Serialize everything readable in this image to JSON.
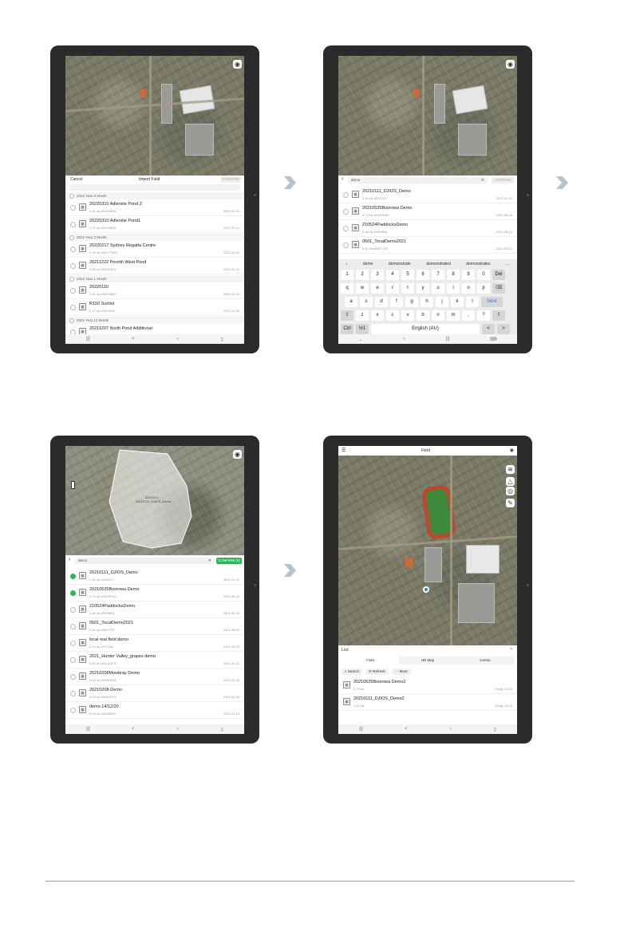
{
  "screen1": {
    "cancel": "Cancel",
    "title": "Import Field",
    "confirm": "CONFIRM",
    "groups": [
      {
        "label": "2022 Year 3 Month",
        "items": [
          {
            "name": "20220310 Adlerslie Pond 2",
            "sub": "0.46 ha #09158DA",
            "date": "2022-03-11"
          },
          {
            "name": "20220310 Adlerslie Pond1",
            "sub": "1.27 ha #09158DE",
            "date": "2022-03-10"
          }
        ]
      },
      {
        "label": "2022 Year 2 Month",
        "items": [
          {
            "name": "20220217 Sydney Regatta Centre",
            "sub": "0.39 ha #091779AC",
            "date": "2022-02-18"
          },
          {
            "name": "20211222 Penrith West Pond",
            "sub": "0.68 ha #09224DA",
            "date": "2022-02-22"
          }
        ]
      },
      {
        "label": "2022 Year 1 Month",
        "items": [
          {
            "name": "20220110",
            "sub": "0.01 ha #0923AB2",
            "date": "2022-01-10"
          },
          {
            "name": "R150 Sunlist",
            "sub": "0.17 ha #0923444",
            "date": "2022-01-06"
          }
        ]
      },
      {
        "label": "2021 Year 12 Month",
        "items": [
          {
            "name": "20211207 North Pond Additional",
            "sub": "",
            "date": ""
          }
        ]
      }
    ]
  },
  "screen2": {
    "search_value": "demo",
    "confirm": "CONFIRM",
    "items": [
      {
        "name": "20210111_DJIOS_Demo",
        "sub": "1.16 ha #0102C7",
        "date": "2021-01-11"
      },
      {
        "name": "20210525Boorowa Demo",
        "sub": "0.79 ha #09AFE8C",
        "date": "2021-05-25"
      },
      {
        "name": "210524PaddocksDemo",
        "sub": "0.48 ha #09A9B6",
        "date": "2021-05-24"
      },
      {
        "name": "0501_TocalDemo2021",
        "sub": "0.41 ha #0507767",
        "date": "2021-05-01"
      }
    ],
    "suggestions": [
      "demo",
      "demonstrate",
      "demonstrated",
      "demonstrates",
      "..."
    ],
    "keys_row1": [
      "1",
      "2",
      "3",
      "4",
      "5",
      "6",
      "7",
      "8",
      "9",
      "0",
      "Del"
    ],
    "keys_row2": [
      "q",
      "w",
      "e",
      "r",
      "t",
      "y",
      "u",
      "i",
      "o",
      "p",
      "⌫"
    ],
    "keys_row3": [
      "a",
      "s",
      "d",
      "f",
      "g",
      "h",
      "j",
      "k",
      "l",
      "Next"
    ],
    "keys_row4": [
      "⇧",
      "z",
      "x",
      "c",
      "v",
      "b",
      "n",
      "m",
      ",",
      "?",
      "⇧"
    ],
    "keys_row5": [
      "Ctrl",
      "!#1",
      "English (AU)",
      "<",
      ">"
    ]
  },
  "screen3": {
    "search_value": "demo",
    "confirm": "CONFIRM (2)",
    "field_label_1": "20210111",
    "field_label_2": "20210111_DJIOS_Demo",
    "items": [
      {
        "name": "20210111_DJIOS_Demo",
        "sub": "1.16 ha #0102C7",
        "date": "2021-01-11",
        "checked": true
      },
      {
        "name": "20210525Boorowa Demo",
        "sub": "0.79 ha #09AFE8C",
        "date": "2021-05-25",
        "checked": true
      },
      {
        "name": "210524PaddocksDemo",
        "sub": "0.48 ha #09A9B6",
        "date": "2021-05-24",
        "checked": false
      },
      {
        "name": "0501_TocalDemo2021",
        "sub": "0.41 ha #0507767",
        "date": "2021-05-01",
        "checked": false
      },
      {
        "name": "local real field demo",
        "sub": "0.33 ha #0175A6",
        "date": "2021-03-09",
        "checked": false
      },
      {
        "name": "2021_Hunter Valley_grapes demo",
        "sub": "0.55 ha #041A1F5",
        "date": "2021-03-13",
        "checked": false
      },
      {
        "name": "20210208Mowbray Demo",
        "sub": "0.08 ha #090E5E8",
        "date": "2021-02-08",
        "checked": false
      },
      {
        "name": "20210208-Demo",
        "sub": "0.09 ha #084FDC1",
        "date": "2021-02-08",
        "checked": false
      },
      {
        "name": "demo 14/12/20",
        "sub": "0.09 ha #0688E63",
        "date": "2020-12-14",
        "checked": false
      }
    ]
  },
  "screen4": {
    "title": "Field",
    "list_title": "List",
    "tabs": [
      "Field",
      "HD Map",
      "Centre"
    ],
    "actions": [
      "Search",
      "Refresh",
      "More"
    ],
    "items": [
      {
        "name": "20210525Boorowa Demo2",
        "sub": "0.79 ha",
        "date": "Today 15:15"
      },
      {
        "name": "20210111_DJIOS_Demo2",
        "sub": "1.16 ha",
        "date": "Today 15:15"
      }
    ]
  },
  "nav": [
    "|||",
    "<",
    "○",
    "▯"
  ],
  "colors": {
    "accent": "#2db55d",
    "frame": "#2b2b2b",
    "arrow": "#b8c4cc"
  }
}
